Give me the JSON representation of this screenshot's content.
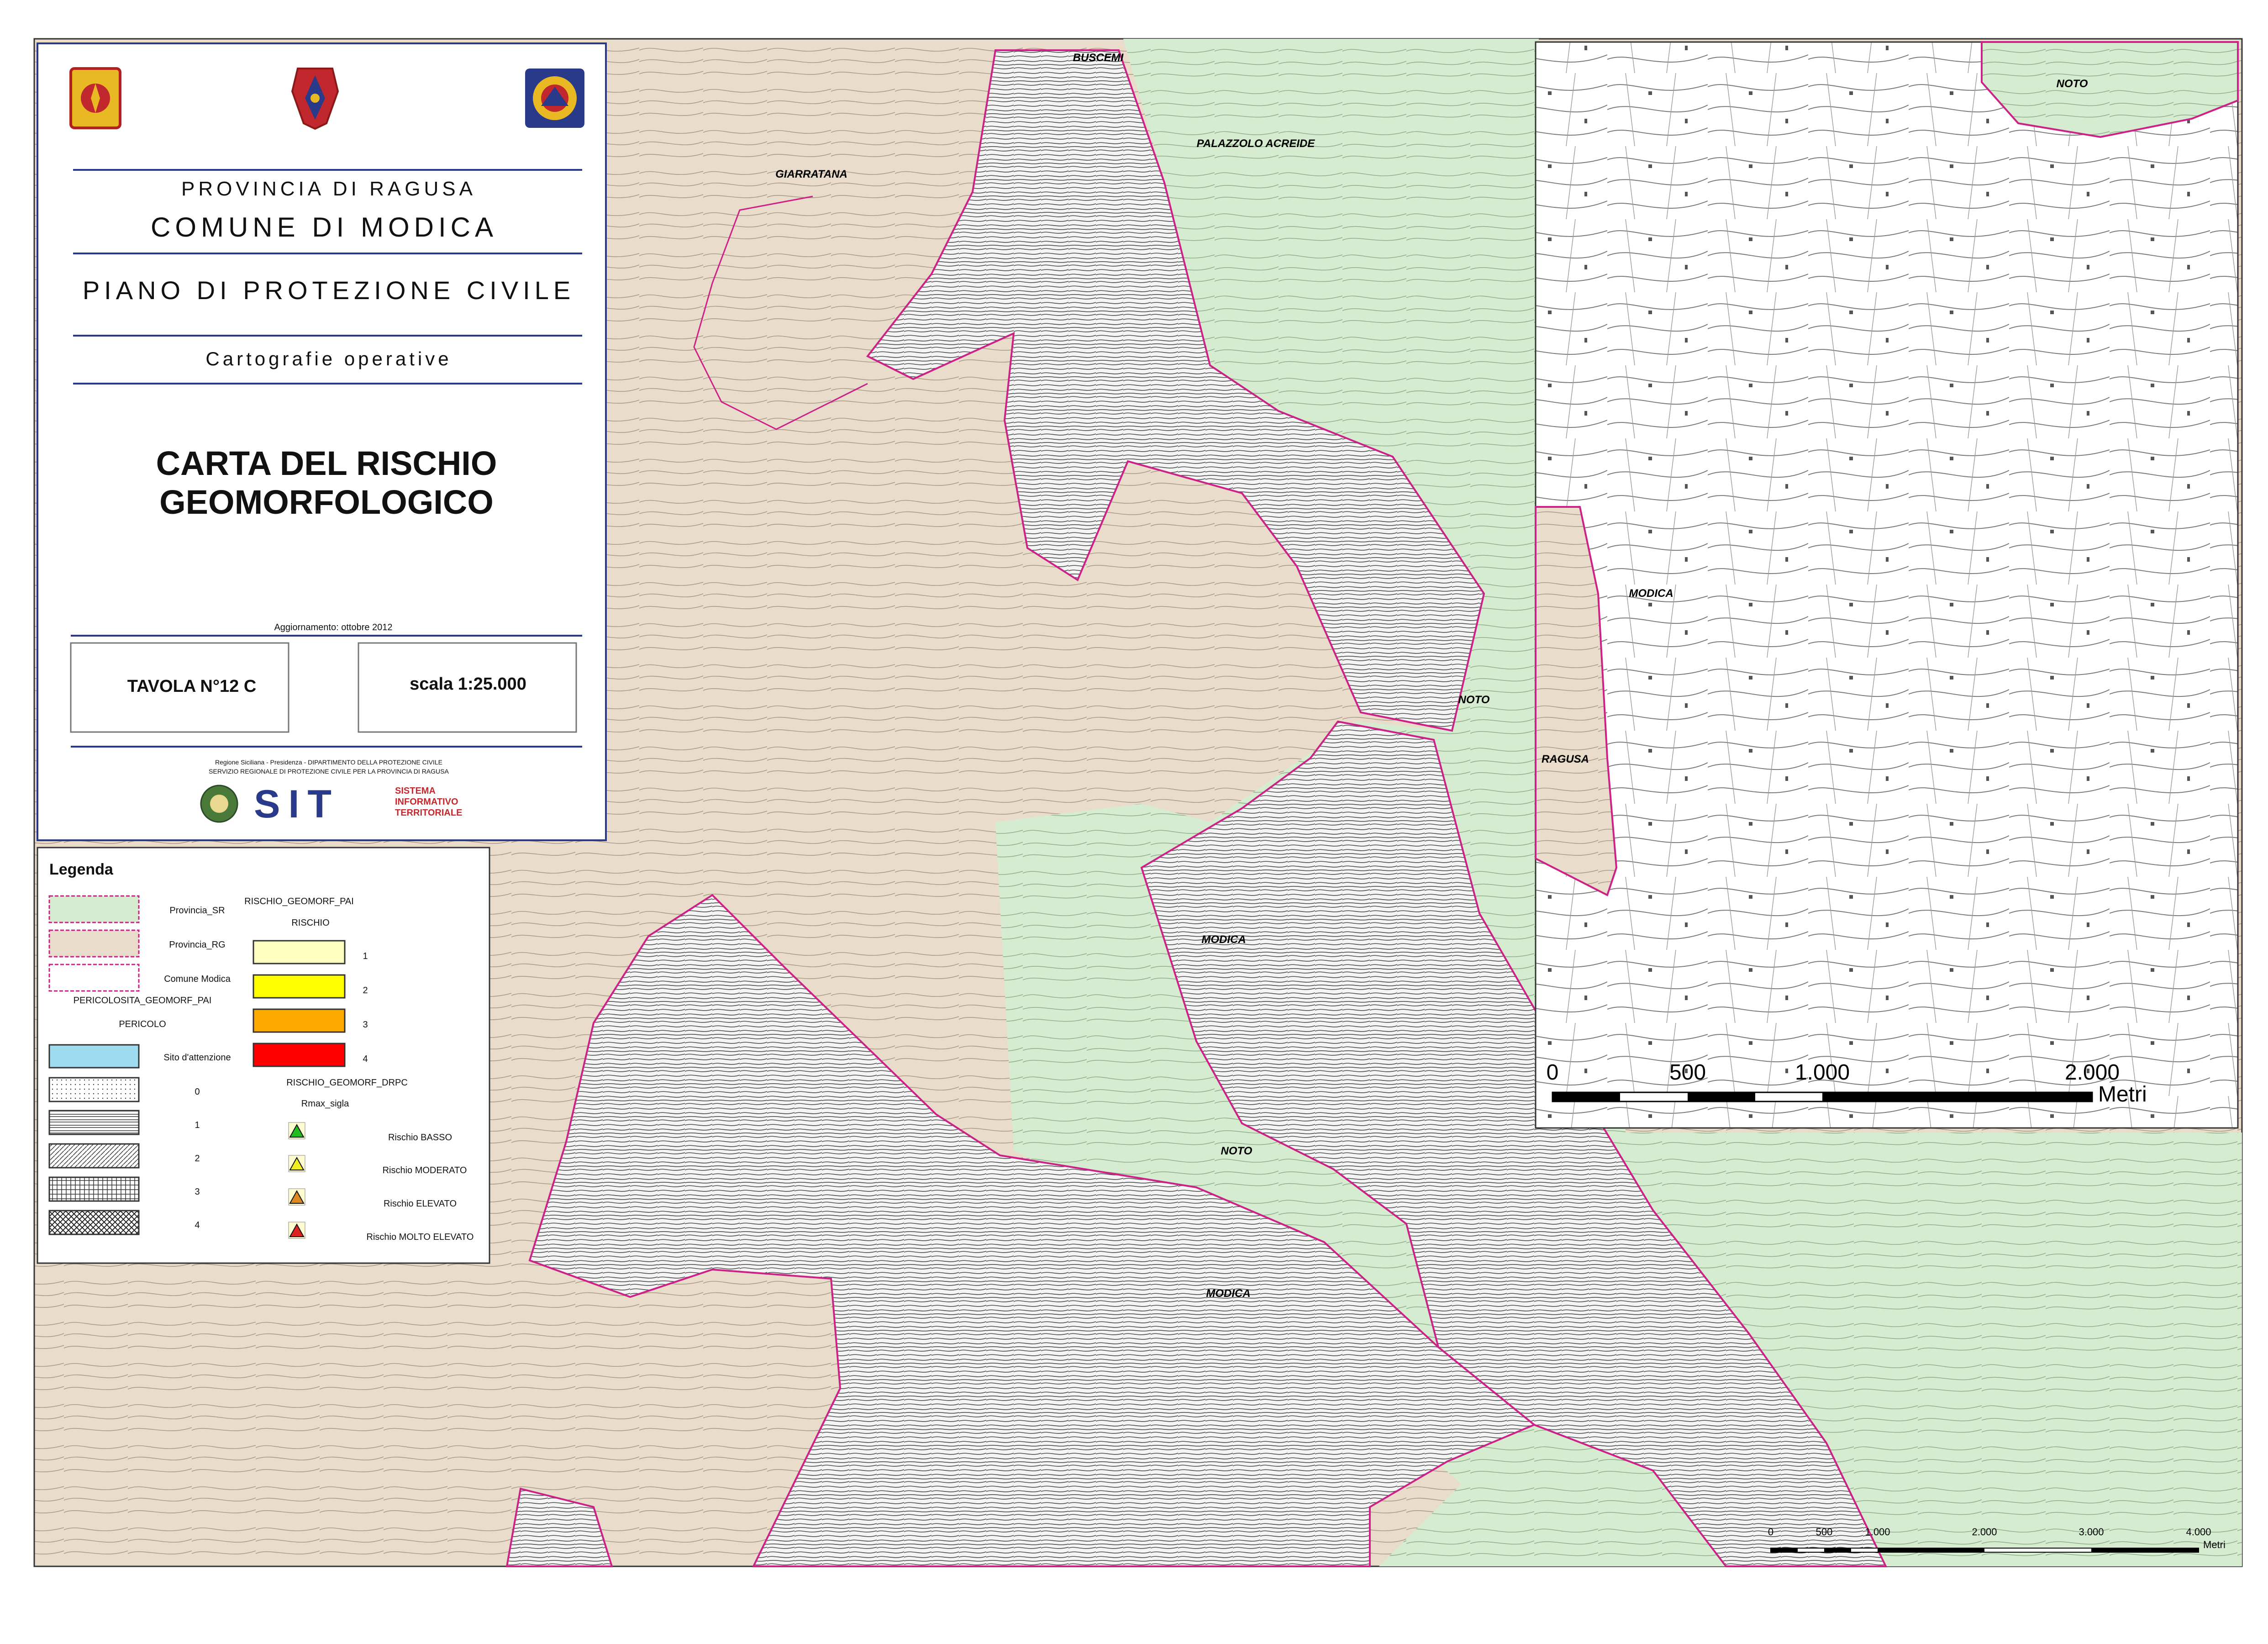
{
  "title_block": {
    "province": "PROVINCIA DI RAGUSA",
    "comune": "COMUNE DI MODICA",
    "plan": "PIANO DI PROTEZIONE CIVILE",
    "subtitle": "Cartografie operative",
    "map_title_line1": "CARTA DEL RISCHIO",
    "map_title_line2": "GEOMORFOLOGICO",
    "update": "Aggiornamento: ottobre 2012",
    "tavola": "TAVOLA N°12 C",
    "scala": "scala 1:25.000",
    "credit_line1": "Regione Siciliana - Presidenza - DIPARTIMENTO DELLA PROTEZIONE CIVILE",
    "credit_line2": "SERVIZIO REGIONALE DI PROTEZIONE CIVILE PER LA PROVINCIA DI RAGUSA",
    "sit_logo": "SIT",
    "sit_text1": "SISTEMA",
    "sit_text2": "INFORMATIVO",
    "sit_text3": "TERRITORIALE"
  },
  "legend": {
    "title": "Legenda",
    "boundaries": [
      "Provincia_SR",
      "Provincia_RG",
      "Comune Modica"
    ],
    "pericolosita_header": "PERICOLOSITA_GEOMORF_PAI",
    "pericolo_header": "PERICOLO",
    "sito": "Sito d'attenzione",
    "pericolo_levels": [
      "0",
      "1",
      "2",
      "3",
      "4"
    ],
    "rischio_pai_header": "RISCHIO_GEOMORF_PAI",
    "rischio_header": "RISCHIO",
    "rischio_levels": [
      "1",
      "2",
      "3",
      "4"
    ],
    "rischio_colors": [
      "#ffffc0",
      "#ffff00",
      "#ffaa00",
      "#ff0000"
    ],
    "drpc_header": "RISCHIO_GEOMORF_DRPC",
    "rmax_header": "Rmax_sigla",
    "drpc_items": [
      "Rischio BASSO",
      "Rischio MODERATO",
      "Rischio ELEVATO",
      "Rischio MOLTO ELEVATO"
    ],
    "drpc_colors": [
      "#22bb22",
      "#eeee22",
      "#dd8822",
      "#dd2222"
    ]
  },
  "places": {
    "buscemi": "BUSCEMI",
    "palazzolo": "PALAZZOLO ACREIDE",
    "giarratana": "GIARRATANA",
    "noto1": "NOTO",
    "modica1": "MODICA",
    "noto2": "NOTO",
    "modica2": "MODICA"
  },
  "inset": {
    "noto": "NOTO",
    "modica": "MODICA",
    "ragusa": "RAGUSA",
    "scale_labels": [
      "0",
      "500",
      "1.000",
      "2.000"
    ],
    "scale_unit": "Metri"
  },
  "main_scale": {
    "labels": [
      "0",
      "500",
      "1.000",
      "2.000",
      "3.000",
      "4.000"
    ],
    "unit": "Metri"
  },
  "colors": {
    "provincia_rg_fill": "#eadccb",
    "provincia_sr_fill": "#d6ecd1",
    "modica_fill": "#f2f2f2",
    "comune_border": "#cc2288",
    "sito_attenzione": "#9fdcf0"
  }
}
